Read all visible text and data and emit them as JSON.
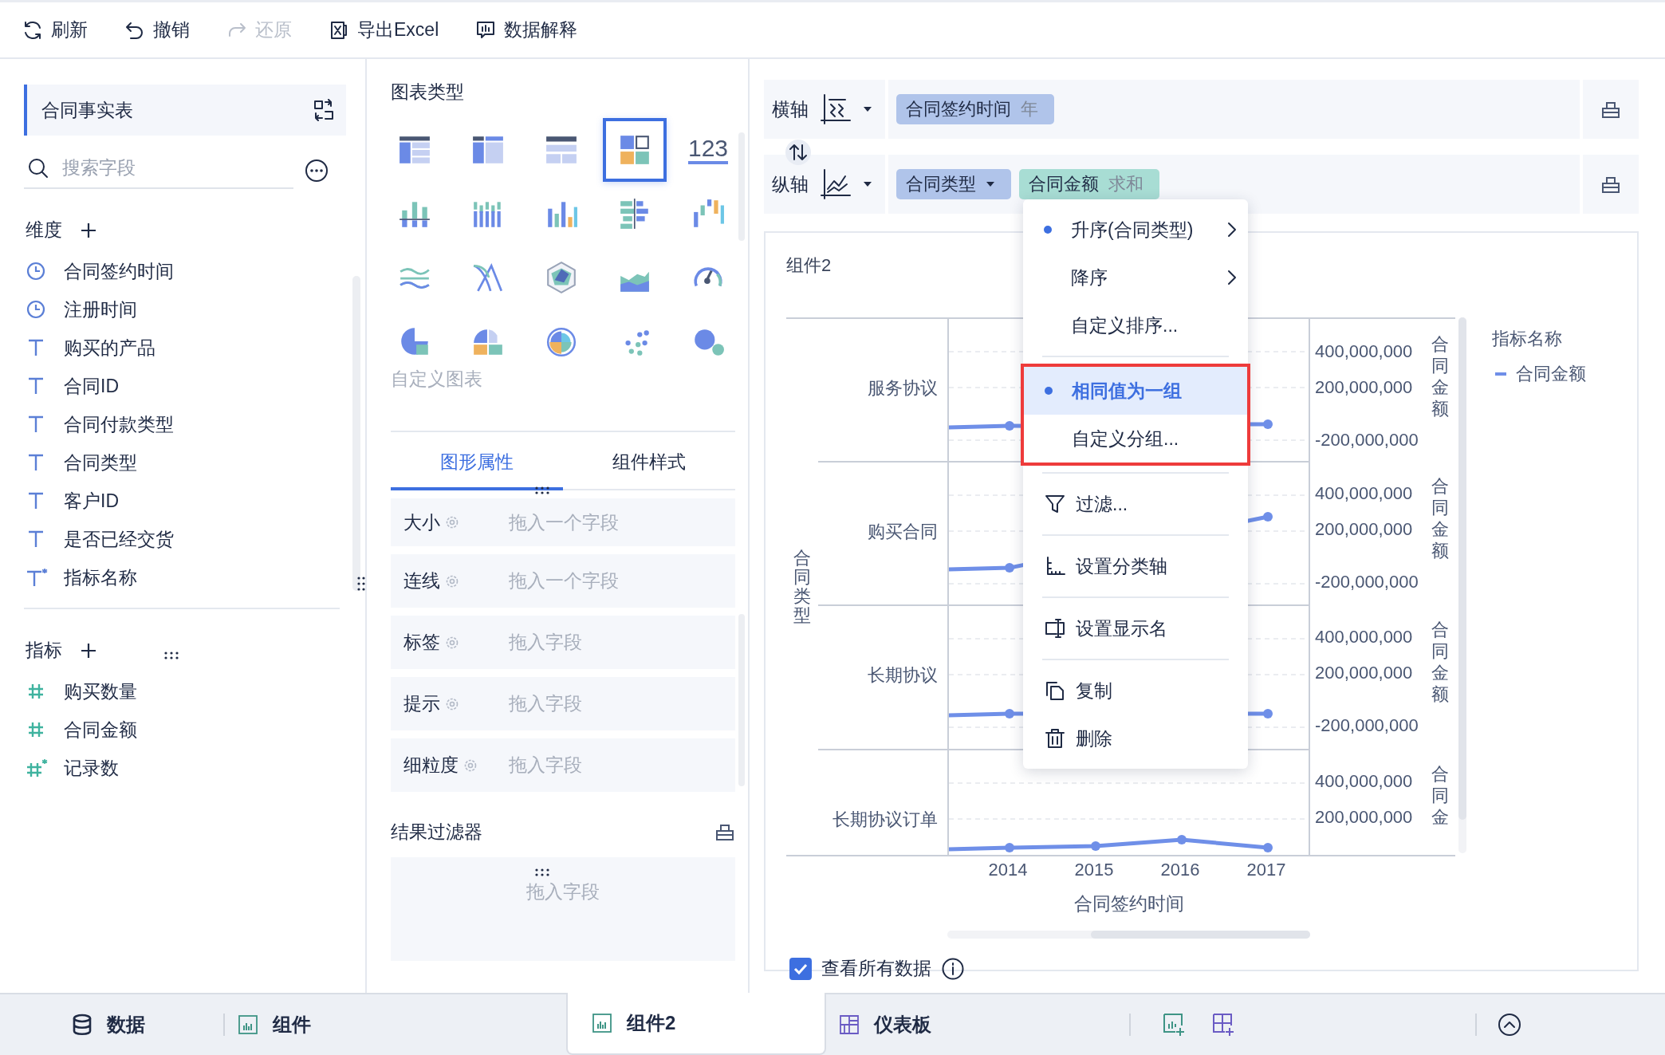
{
  "toolbar": [
    {
      "label": "刷新",
      "kind": "refresh",
      "disabled": false
    },
    {
      "label": "撤销",
      "kind": "undo",
      "disabled": false
    },
    {
      "label": "还原",
      "kind": "redo",
      "disabled": true
    },
    {
      "label": "导出Excel",
      "kind": "export",
      "disabled": false
    },
    {
      "label": "数据解释",
      "kind": "explain",
      "disabled": false
    }
  ],
  "data_panel": {
    "table": "合同事实表",
    "search": {
      "placeholder": "搜索字段"
    },
    "sections": [
      {
        "title": "维度",
        "fields": [
          {
            "name": "合同签约时间",
            "kind": "date"
          },
          {
            "name": "注册时间",
            "kind": "date"
          },
          {
            "name": "购买的产品",
            "kind": "text"
          },
          {
            "name": "合同ID",
            "kind": "text"
          },
          {
            "name": "合同付款类型",
            "kind": "text"
          },
          {
            "name": "合同类型",
            "kind": "text"
          },
          {
            "name": "客户ID",
            "kind": "text"
          },
          {
            "name": "是否已经交货",
            "kind": "text"
          },
          {
            "name": "指标名称",
            "kind": "calc-text"
          }
        ]
      },
      {
        "title": "指标",
        "fields": [
          {
            "name": "购买数量",
            "kind": "number"
          },
          {
            "name": "合同金额",
            "kind": "number"
          },
          {
            "name": "记录数",
            "kind": "calc-number"
          }
        ]
      }
    ]
  },
  "chart_types": {
    "title": "图表类型",
    "items": [
      {
        "kind": "table-detail",
        "selected": false
      },
      {
        "kind": "table-group",
        "selected": false
      },
      {
        "kind": "table-cross",
        "selected": false
      },
      {
        "kind": "custom",
        "selected": true
      },
      {
        "kind": "number",
        "label": "123",
        "selected": false
      },
      {
        "kind": "bar-stacked",
        "selected": false
      },
      {
        "kind": "bar-grouped",
        "selected": false
      },
      {
        "kind": "bar",
        "selected": false
      },
      {
        "kind": "bar-horizontal",
        "selected": false
      },
      {
        "kind": "bar-range",
        "selected": false
      },
      {
        "kind": "line-multi",
        "selected": false
      },
      {
        "kind": "line-cross",
        "selected": false
      },
      {
        "kind": "radar",
        "selected": false
      },
      {
        "kind": "area",
        "selected": false
      },
      {
        "kind": "gauge",
        "selected": false
      },
      {
        "kind": "pie",
        "selected": false
      },
      {
        "kind": "pie-multi",
        "selected": false
      },
      {
        "kind": "rose",
        "selected": false
      },
      {
        "kind": "scatter",
        "selected": false
      },
      {
        "kind": "bubble",
        "selected": false
      }
    ],
    "custom_label": "自定义图表"
  },
  "tabs": [
    {
      "label": "图形属性",
      "selected": true
    },
    {
      "label": "组件样式",
      "selected": false
    }
  ],
  "properties": [
    {
      "label": "大小",
      "placeholder": "拖入一个字段"
    },
    {
      "label": "连线",
      "placeholder": "拖入一个字段"
    },
    {
      "label": "标签",
      "placeholder": "拖入字段"
    },
    {
      "label": "提示",
      "placeholder": "拖入字段"
    },
    {
      "label": "细粒度",
      "placeholder": "拖入字段"
    }
  ],
  "result_filter": {
    "title": "结果过滤器",
    "placeholder": "拖入字段"
  },
  "axes": [
    {
      "label": "横轴",
      "kind": "x",
      "fields": [
        {
          "name": "合同签约时间",
          "aggregation": "年",
          "kind": "dimension",
          "dropdown": false
        }
      ]
    },
    {
      "label": "纵轴",
      "kind": "y",
      "fields": [
        {
          "name": "合同类型",
          "kind": "dimension",
          "dropdown": true
        },
        {
          "name": "合同金额",
          "aggregation": "求和",
          "kind": "measure",
          "dropdown": false
        }
      ]
    }
  ],
  "chart": {
    "title": "组件2",
    "y_axis_title": "合同类型",
    "rows": [
      {
        "category": "服务协议",
        "ticks": [
          "400,000,000",
          "200,000,000",
          "-200,000,000"
        ],
        "axis_title": "合同金额"
      },
      {
        "category": "购买合同",
        "ticks": [
          "400,000,000",
          "200,000,000",
          "-200,000,000"
        ],
        "axis_title": "合同金额"
      },
      {
        "category": "长期协议",
        "ticks": [
          "400,000,000",
          "200,000,000",
          "-200,000,000"
        ],
        "axis_title": "合同金额"
      },
      {
        "category": "长期协议订单",
        "ticks": [
          "400,000,000",
          "200,000,000"
        ],
        "axis_title": "合同金"
      }
    ],
    "x_ticks": [
      "2014",
      "2015",
      "2016",
      "2017"
    ],
    "x_axis_title": "合同签约时间",
    "legend": {
      "title": "指标名称",
      "items": [
        {
          "name": "合同金额",
          "color": "#6f8fe8"
        }
      ]
    }
  },
  "view_all": {
    "label": "查看所有数据",
    "checked": true
  },
  "menu": {
    "groups": [
      {
        "highlighted": false,
        "items": [
          {
            "label": "升序(合同类型)",
            "kind": "option",
            "selected": true,
            "submenu": true
          },
          {
            "label": "降序",
            "kind": "option",
            "selected": false,
            "submenu": true
          },
          {
            "label": "自定义排序...",
            "kind": "option",
            "selected": false,
            "submenu": false
          }
        ]
      },
      {
        "highlighted": true,
        "items": [
          {
            "label": "相同值为一组",
            "kind": "option",
            "selected": true,
            "submenu": false
          },
          {
            "label": "自定义分组...",
            "kind": "option",
            "selected": false,
            "submenu": false
          }
        ]
      },
      {
        "highlighted": false,
        "items": [
          {
            "label": "过滤...",
            "kind": "filter"
          }
        ]
      },
      {
        "highlighted": false,
        "items": [
          {
            "label": "设置分类轴",
            "kind": "axis"
          }
        ]
      },
      {
        "highlighted": false,
        "items": [
          {
            "label": "设置显示名",
            "kind": "rename"
          }
        ]
      },
      {
        "highlighted": false,
        "items": [
          {
            "label": "复制",
            "kind": "copy"
          },
          {
            "label": "删除",
            "kind": "delete"
          }
        ]
      }
    ]
  },
  "bottom_tabs": [
    {
      "label": "数据",
      "kind": "data",
      "selected": false
    },
    {
      "label": "组件",
      "kind": "widget",
      "selected": false
    },
    {
      "label": "组件2",
      "kind": "widget",
      "selected": true
    },
    {
      "label": "仪表板",
      "kind": "dashboard",
      "selected": false
    }
  ]
}
